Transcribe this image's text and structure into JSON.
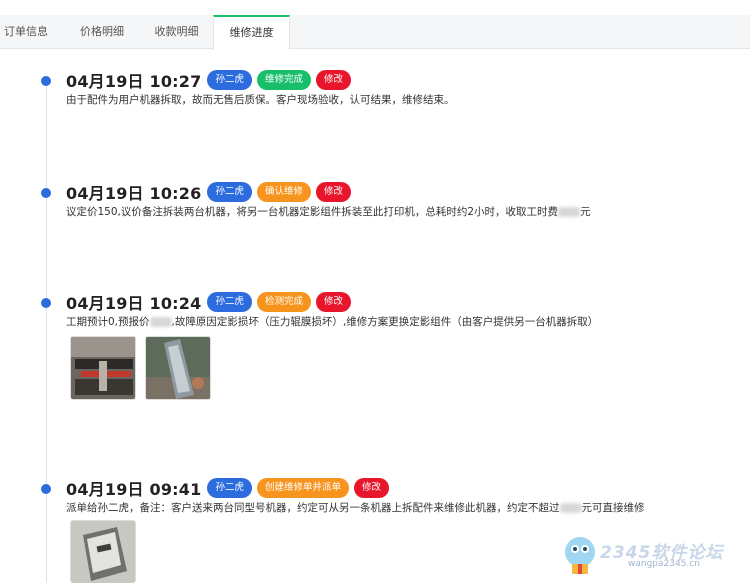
{
  "tabs": [
    {
      "label": "订单信息",
      "active": false
    },
    {
      "label": "价格明细",
      "active": false
    },
    {
      "label": "收款明细",
      "active": false
    },
    {
      "label": "维修进度",
      "active": true
    }
  ],
  "entries": [
    {
      "time": "04月19日 10:27",
      "technician": "孙二虎",
      "status": "维修完成",
      "status_color": "#19be6b",
      "edit_label": "修改",
      "desc_parts": [
        "由于配件为用户机器拆取，故而无售后质保。客户现场验收，认可结果，维修结束。"
      ]
    },
    {
      "time": "04月19日 10:26",
      "technician": "孙二虎",
      "status": "确认维修",
      "status_color": "#f7941d",
      "edit_label": "修改",
      "desc_parts": [
        "议定价150,议价备注拆装两台机器，将另一台机器定影组件拆装至此打印机，总耗时约2小时，收取工时费",
        "元"
      ]
    },
    {
      "time": "04月19日 10:24",
      "technician": "孙二虎",
      "status": "检测完成",
      "status_color": "#f7941d",
      "edit_label": "修改",
      "desc_parts": [
        "工期预计0,预报价",
        ",故障原因定影损坏（压力辊膜损坏）,维修方案更换定影组件（由客户提供另一台机器拆取）"
      ],
      "photos": [
        "fuser-photo-1",
        "fuser-photo-2"
      ]
    },
    {
      "time": "04月19日 09:41",
      "technician": "孙二虎",
      "status": "创建维修单并派单",
      "status_color": "#f7941d",
      "edit_label": "修改",
      "desc_parts": [
        "派单给孙二虎，备注：客户送来两台同型号机器，约定可从另一条机器上拆配件来维修此机器，约定不超过",
        "元可直接维修"
      ],
      "photos": [
        "printer-part-photo"
      ]
    }
  ],
  "colors": {
    "accent": "#2d6cdf",
    "success": "#19be6b",
    "warning": "#f7941d",
    "danger": "#e8152b"
  },
  "watermark": {
    "title": "2345软件论坛",
    "subtitle": "wangpa2345.cn"
  }
}
